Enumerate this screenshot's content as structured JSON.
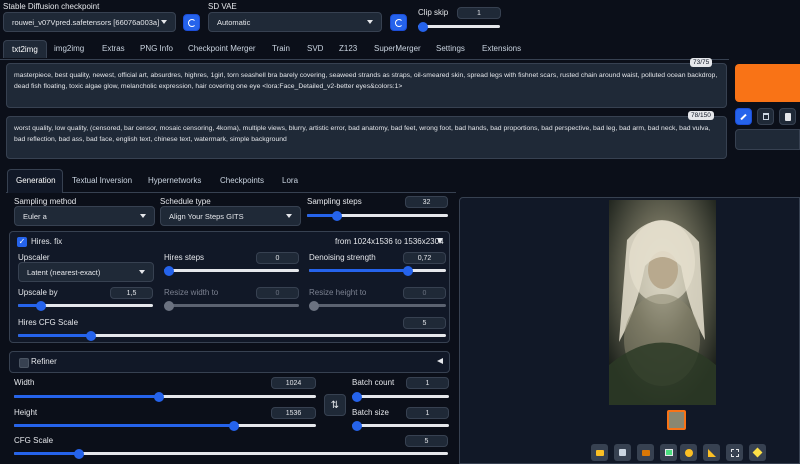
{
  "top": {
    "checkpoint_label": "Stable Diffusion checkpoint",
    "checkpoint_value": "rouwei_v07Vpred.safetensors [66076a003a]",
    "vae_label": "SD VAE",
    "vae_value": "Automatic",
    "clip_label": "Clip skip",
    "clip_value": "1",
    "clip_fraction": 0.0
  },
  "tabs": [
    "txt2img",
    "img2img",
    "Extras",
    "PNG Info",
    "Checkpoint Merger",
    "Train",
    "SVD",
    "Z123",
    "SuperMerger",
    "Settings",
    "Extensions"
  ],
  "prompt": {
    "positive": "masterpiece, best quality, newest, official art, absurdres, highres, 1girl, torn seashell bra barely covering, seaweed strands as straps, oil-smeared skin, spread legs with fishnet scars, rusted chain around waist, polluted ocean backdrop, dead fish floating, toxic algae glow, melancholic expression, hair covering one eye  <lora:Face_Detailed_v2-better eyes&colors:1>",
    "positive_count": "73/75",
    "negative": "worst quality, low quality, (censored, bar censor, mosaic censoring, 4koma), multiple views, blurry, artistic error, bad anatomy, bad feet, wrong foot, bad hands, bad proportions, bad perspective, bad leg, bad arm, bad neck, bad vulva, bad reflection, bad ass, bad face, english text, chinese text, watermark, simple background",
    "negative_count": "78/150"
  },
  "subtabs": [
    "Generation",
    "Textual Inversion",
    "Hypernetworks",
    "Checkpoints",
    "Lora"
  ],
  "gen": {
    "sampling_method_label": "Sampling method",
    "sampling_method": "Euler a",
    "schedule_label": "Schedule type",
    "schedule": "Align Your Steps GITS",
    "steps_label": "Sampling steps",
    "steps": "32",
    "steps_fraction": 0.21
  },
  "hires": {
    "label": "Hires. fix",
    "info": "from 1024x1536  to 1536x2304",
    "upscaler_label": "Upscaler",
    "upscaler": "Latent (nearest-exact)",
    "steps_label": "Hires steps",
    "steps": "0",
    "steps_fraction": 0.0,
    "denoise_label": "Denoising strength",
    "denoise": "0,72",
    "denoise_fraction": 0.72,
    "upscale_label": "Upscale by",
    "upscale": "1,5",
    "upscale_fraction": 0.17,
    "resize_w_label": "Resize width to",
    "resize_w": "0",
    "resize_h_label": "Resize height to",
    "resize_h": "0",
    "cfg_label": "Hires CFG Scale",
    "cfg": "5",
    "cfg_fraction": 0.17
  },
  "refiner_label": "Refiner",
  "size": {
    "width_label": "Width",
    "width": "1024",
    "width_fraction": 0.48,
    "height_label": "Height",
    "height": "1536",
    "height_fraction": 0.73,
    "batch_count_label": "Batch count",
    "batch_count": "1",
    "batch_count_fraction": 0.0,
    "batch_size_label": "Batch size",
    "batch_size": "1",
    "batch_size_fraction": 0.0,
    "swap_icon": "⇅",
    "cfg_label": "CFG Scale",
    "cfg": "5",
    "cfg_fraction": 0.15
  },
  "colors": {
    "accent": "#2563eb",
    "generate": "#f97316",
    "bg": "#0b0f19"
  }
}
